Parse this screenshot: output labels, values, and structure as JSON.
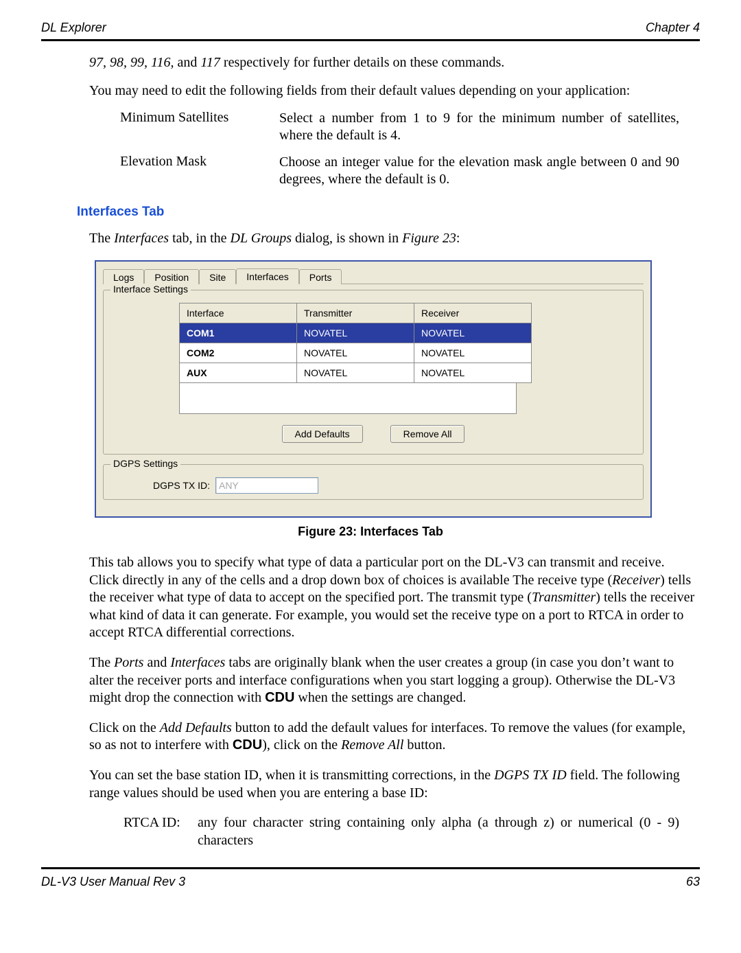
{
  "header": {
    "left": "DL Explorer",
    "right": "Chapter 4"
  },
  "intro": {
    "line1_prefix_italics": "97, 98, 99, 116, ",
    "line1_mid": "and ",
    "line1_last_italic": "117",
    "line1_rest": " respectively for further details on these commands.",
    "line2": "You may need to edit the following fields from their default values depending on your application:"
  },
  "fields": [
    {
      "label": "Minimum Satellites",
      "desc": "Select a number from 1 to 9 for the minimum number of satellites, where the default is 4."
    },
    {
      "label": "Elevation Mask",
      "desc": "Choose an integer value for the elevation mask angle between 0 and 90 degrees, where the default is 0."
    }
  ],
  "section_head": "Interfaces Tab",
  "section_intro": {
    "pre": "The ",
    "it1": "Interfaces",
    "mid1": " tab, in the ",
    "it2": "DL Groups",
    "mid2": " dialog, is shown in ",
    "it3": "Figure 23",
    "tail": ":"
  },
  "dlg": {
    "tabs": [
      "Logs",
      "Position",
      "Site",
      "Interfaces",
      "Ports"
    ],
    "active_tab_index": 3,
    "group1_title": "Interface Settings",
    "table": {
      "headers": [
        "Interface",
        "Transmitter",
        "Receiver"
      ],
      "rows": [
        {
          "interface": "COM1",
          "tx": "NOVATEL",
          "rx": "NOVATEL",
          "selected": true
        },
        {
          "interface": "COM2",
          "tx": "NOVATEL",
          "rx": "NOVATEL",
          "selected": false
        },
        {
          "interface": "AUX",
          "tx": "NOVATEL",
          "rx": "NOVATEL",
          "selected": false
        }
      ]
    },
    "btn_add": "Add Defaults",
    "btn_remove": "Remove All",
    "group2_title": "DGPS Settings",
    "dgps_label": "DGPS TX ID:",
    "dgps_value": "ANY"
  },
  "fig_caption": "Figure 23: Interfaces Tab",
  "p1": {
    "s1": "This tab allows you to specify what type of data a particular port on the DL-V3 can transmit and receive. Click directly in any of the cells and a drop down box of choices is available The receive type (",
    "it1": "Receiver",
    "s2": ") tells the receiver what type of data to accept on the specified port. The transmit type (",
    "it2": "Transmitter",
    "s3": ") tells the receiver what kind of data it can generate. For example, you would set the receive type on a port to RTCA in order to accept RTCA differential corrections."
  },
  "p2": {
    "s1": "The ",
    "it1": "Ports",
    "s2": " and ",
    "it2": "Interfaces",
    "s3": " tabs are originally blank when the user creates a group (in case you don’t want to alter the receiver ports and interface configurations when you start logging a group). Otherwise the DL-V3 might drop the connection with ",
    "bf1": "CDU",
    "s4": " when the settings are changed."
  },
  "p3": {
    "s1": "Click on the ",
    "it1": "Add Defaults",
    "s2": " button to add the default values for interfaces. To remove the values (for example, so as not to interfere with ",
    "bf1": "CDU",
    "s3": "), click on the ",
    "it2": "Remove All",
    "s4": " button."
  },
  "p4": {
    "s1": "You can set the base station ID, when it is transmitting corrections, in the ",
    "it1": "DGPS TX ID",
    "s2": " field. The following range values should be used when you are entering a base ID:"
  },
  "def": {
    "label": "RTCA ID:",
    "body": "any four character string containing only alpha (a through z) or numerical (0 - 9) characters"
  },
  "footer": {
    "left": "DL-V3 User Manual Rev 3",
    "right": "63"
  }
}
